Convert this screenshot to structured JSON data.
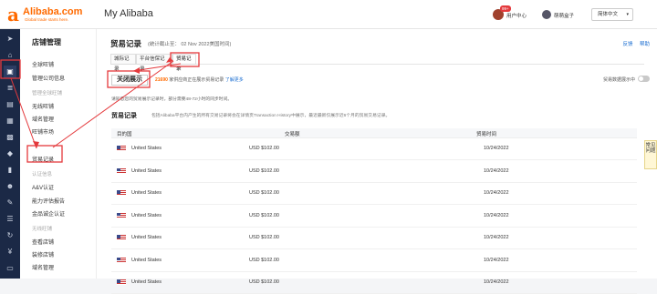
{
  "header": {
    "logo_mark": "a",
    "logo_text": "Alibaba.com",
    "logo_tagline": "Global trade starts here.",
    "app_title": "My Alibaba",
    "notification_count": "99+",
    "user_center": "用户中心",
    "user_name": "萌萌盒子",
    "language": "简体中文"
  },
  "left_nav": {
    "heading": "店铺管理",
    "items": [
      {
        "label": "全球旺铺",
        "kind": "item"
      },
      {
        "label": "管理公司信息",
        "kind": "item"
      },
      {
        "label": "管理全球旺铺",
        "kind": "section"
      },
      {
        "label": "无线旺铺",
        "kind": "item"
      },
      {
        "label": "域名管理",
        "kind": "item"
      },
      {
        "label": "旺铺市场",
        "kind": "item"
      },
      {
        "label": "贸易记录",
        "kind": "item"
      },
      {
        "label": "认证信息",
        "kind": "section"
      },
      {
        "label": "A&V认证",
        "kind": "item"
      },
      {
        "label": "能力评估报告",
        "kind": "item"
      },
      {
        "label": "金品诚企认证",
        "kind": "item"
      },
      {
        "label": "无线旺铺",
        "kind": "section"
      },
      {
        "label": "查看店铺",
        "kind": "item"
      },
      {
        "label": "装修店铺",
        "kind": "item"
      },
      {
        "label": "域名管理",
        "kind": "item"
      }
    ]
  },
  "page": {
    "title": "贸易记录",
    "subtitle": "(统计截止至： 02 Nov 2022美国时间)",
    "link_feedback": "反馈",
    "link_help": "帮助",
    "tabs": [
      "城际记录",
      "平台信保记录",
      "贸易记录"
    ],
    "active_tab": 2,
    "close_button": "关闭展示",
    "notice_count": "21690",
    "notice_text": "家供应商正在展示贸易记录",
    "notice_link": "了解更多",
    "showing_label": "贸易数据展示中",
    "hint": "请知悉您的贸易展示记录时，部分需要48-72小时的同步时间。",
    "records_title": "贸易记录",
    "records_desc": "包括Alibaba平台内产生的所有交易记录将会在详情页Transaction History中展示，最近最新仅展示近6个月的贸易交易记录。",
    "help_widget": "常见问题"
  },
  "table": {
    "columns": [
      "目的国",
      "交易额",
      "贸易时间"
    ],
    "rows": [
      {
        "country": "United States",
        "amount": "USD $102.00",
        "date": "10/24/2022"
      },
      {
        "country": "United States",
        "amount": "USD $102.00",
        "date": "10/24/2022"
      },
      {
        "country": "United States",
        "amount": "USD $102.00",
        "date": "10/24/2022"
      },
      {
        "country": "United States",
        "amount": "USD $102.00",
        "date": "10/24/2022"
      },
      {
        "country": "United States",
        "amount": "USD $102.00",
        "date": "10/24/2022"
      },
      {
        "country": "United States",
        "amount": "USD $102.00",
        "date": "10/24/2022"
      },
      {
        "country": "United States",
        "amount": "USD $102.00",
        "date": "10/24/2022"
      }
    ]
  },
  "rail_icons": [
    "send-icon",
    "home-icon",
    "store-icon",
    "list-icon",
    "box-icon",
    "grid-icon",
    "grid-icon",
    "tag-icon",
    "chart-icon",
    "people-icon",
    "tool-icon",
    "doc-icon",
    "refresh-icon",
    "money-icon",
    "calendar-icon"
  ],
  "colors": {
    "brand": "#ff6a00",
    "annotation": "#e4393c",
    "link": "#1b6ed1",
    "rail": "#1b2946"
  }
}
